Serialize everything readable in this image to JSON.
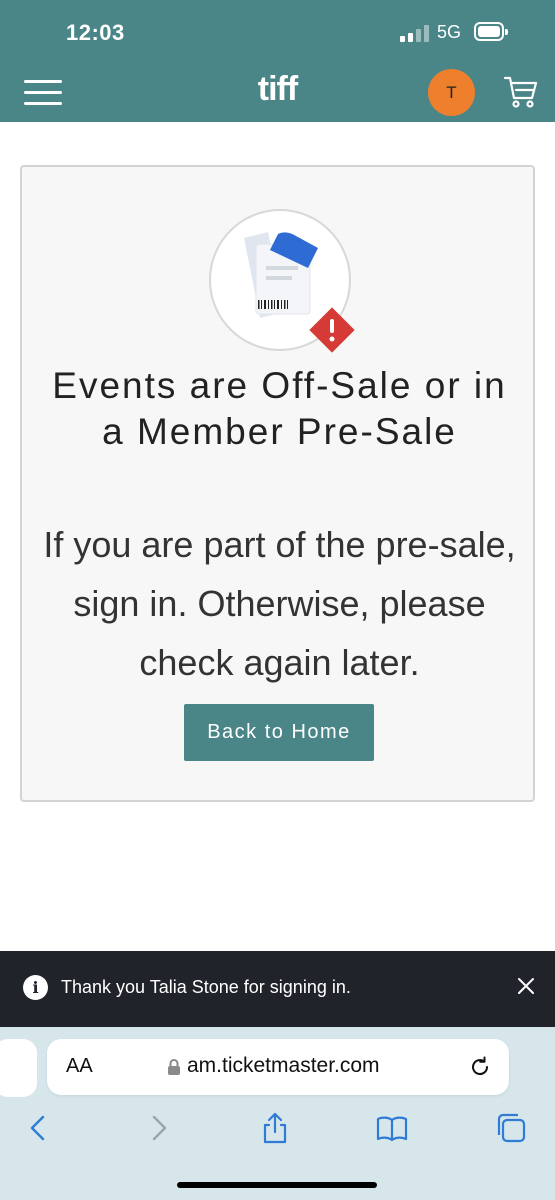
{
  "status_bar": {
    "time": "12:03",
    "network": "5G",
    "icons": [
      "signal-bars-icon",
      "battery-icon"
    ]
  },
  "header": {
    "logo": "tiff",
    "avatar_initial": "T",
    "icons": [
      "hamburger-menu-icon",
      "cart-icon"
    ],
    "colors": {
      "background": "#4a8587",
      "avatar": "#ee7f2d"
    }
  },
  "main": {
    "illustration": "ticket-warning-illustration",
    "headline": "Events are Off-Sale or in a Member Pre-Sale",
    "message": "If you are part of the pre-sale, sign in. Otherwise, please check again later.",
    "button_label": "Back to Home",
    "colors": {
      "button": "#4a8587",
      "warning": "#d63a36",
      "ticket_accent": "#2e6bd3"
    }
  },
  "toast": {
    "message": "Thank you Talia Stone for signing in.",
    "icons": [
      "info-icon",
      "close-icon"
    ]
  },
  "browser": {
    "text_size_label": "AA",
    "url": "am.ticketmaster.com",
    "icons": [
      "lock-icon",
      "reload-icon",
      "back-icon",
      "forward-icon",
      "share-icon",
      "bookmarks-icon",
      "tabs-icon"
    ]
  }
}
